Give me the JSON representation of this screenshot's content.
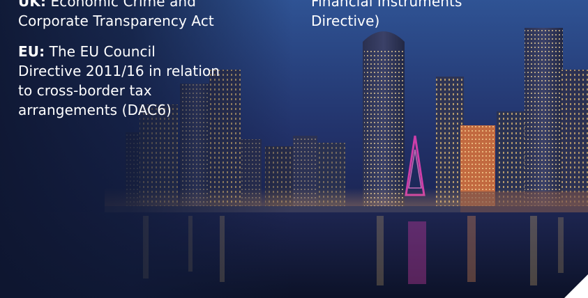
{
  "uk": {
    "prefix": "UK:",
    "line1": " Economic Crime and",
    "line2": "Corporate Transparency Act"
  },
  "eu": {
    "prefix": "EU:",
    "line1": " The EU Council",
    "line2": "Directive 2011/16 in relation",
    "line3": "to cross-border tax",
    "line4": "arrangements (DAC6)"
  },
  "mifid": {
    "line1": "Financial Instruments",
    "line2": "Directive)"
  },
  "colors": {
    "sky_top": "#2a4a8a",
    "sky_mid": "#1c2a55",
    "water": "#0e1630",
    "accent_pink": "#e040b0",
    "light_yellow": "#ffd27a"
  }
}
